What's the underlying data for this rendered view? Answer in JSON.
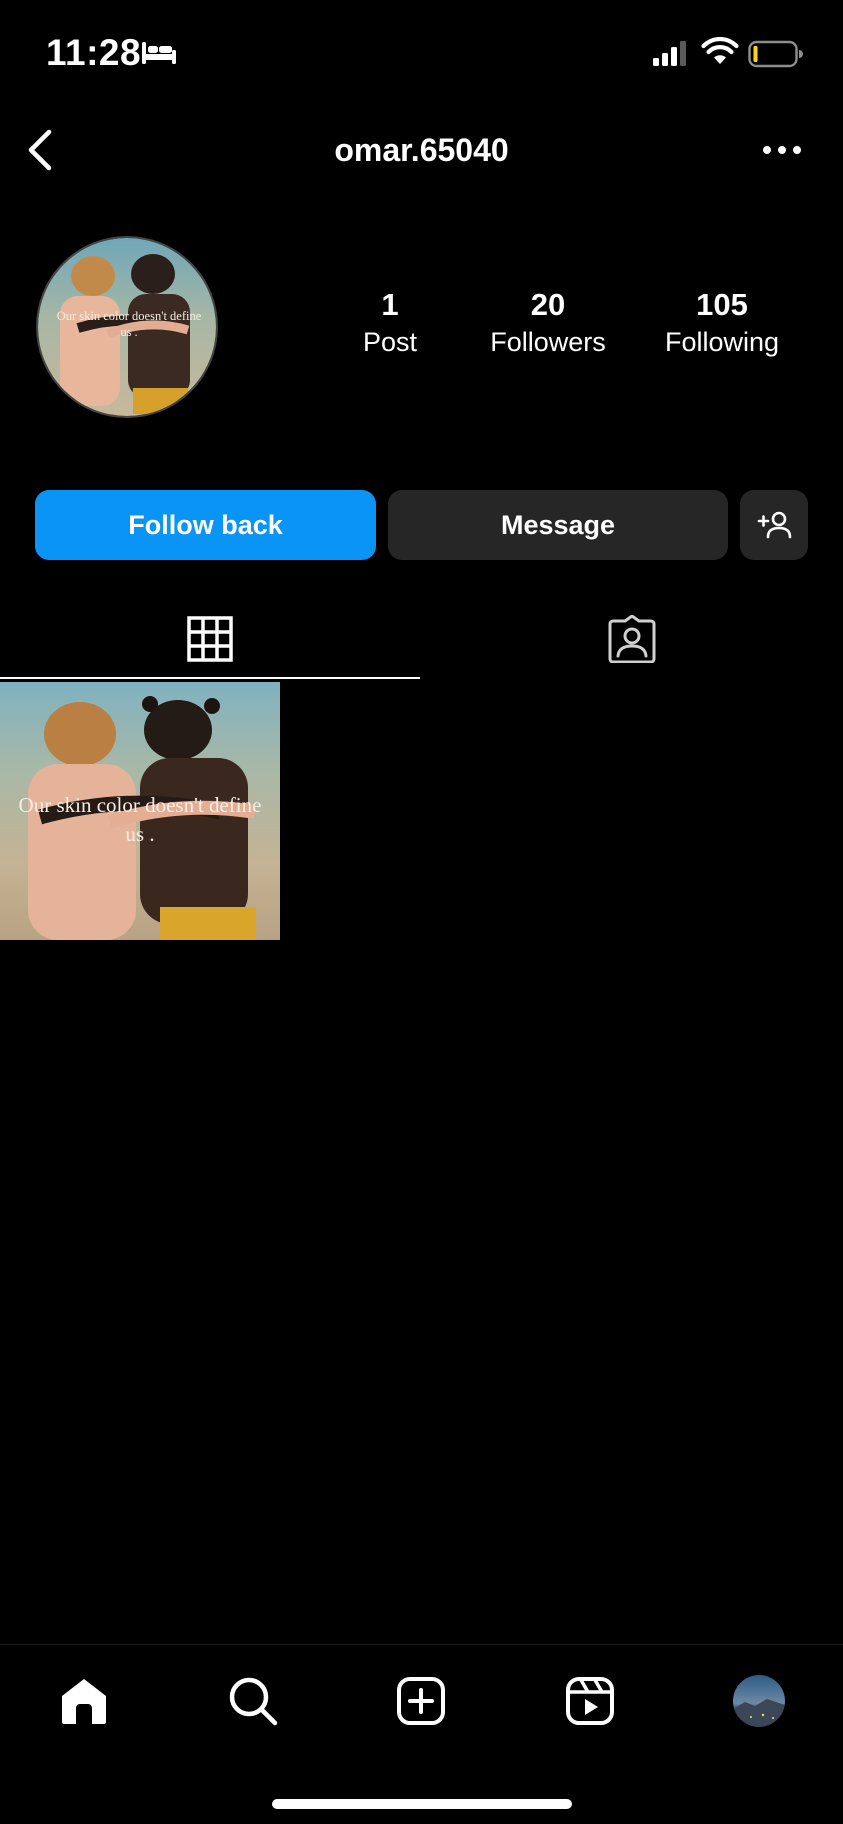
{
  "status_bar": {
    "time": "11:28"
  },
  "header": {
    "username": "omar.65040"
  },
  "profile": {
    "avatar_caption_line1": "Our skin color doesn't define",
    "avatar_caption_line2": "us ."
  },
  "stats": [
    {
      "value": "1",
      "label": "Post"
    },
    {
      "value": "20",
      "label": "Followers"
    },
    {
      "value": "105",
      "label": "Following"
    }
  ],
  "actions": {
    "follow_back_label": "Follow back",
    "message_label": "Message"
  },
  "tabs": {
    "active": "grid"
  },
  "posts": [
    {
      "caption_line1": "Our skin color doesn't define",
      "caption_line2": "us ."
    }
  ],
  "colors": {
    "background": "#000000",
    "primary_button": "#0a95f6",
    "secondary_button": "#262626",
    "text": "#ffffff"
  },
  "icons": {
    "back": "chevron-left-icon",
    "more": "more-horizontal-icon",
    "add_user": "add-user-icon",
    "grid_tab": "grid-icon",
    "tagged_tab": "tagged-person-icon",
    "nav": [
      "home-icon",
      "search-icon",
      "create-icon",
      "reels-icon",
      "profile-avatar"
    ]
  }
}
